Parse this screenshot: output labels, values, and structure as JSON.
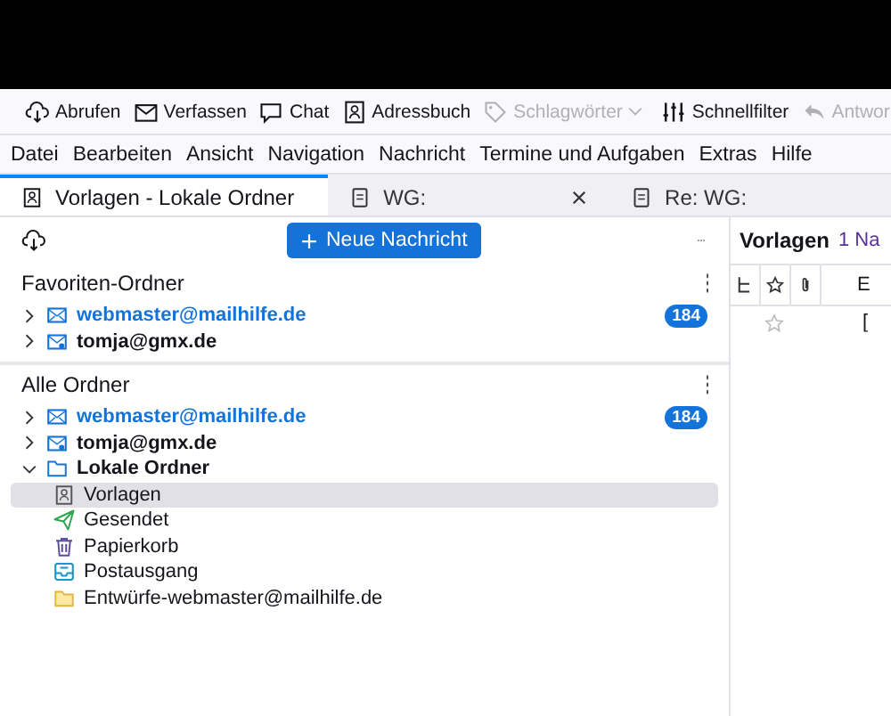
{
  "toolbar": {
    "buttons": [
      {
        "label": "Abrufen",
        "kind": "fetch",
        "disabled": false,
        "dropdown": false
      },
      {
        "label": "Verfassen",
        "kind": "compose",
        "disabled": false,
        "dropdown": false
      },
      {
        "label": "Chat",
        "kind": "chat",
        "disabled": false,
        "dropdown": false
      },
      {
        "label": "Adressbuch",
        "kind": "addressbook",
        "disabled": false,
        "dropdown": false
      },
      {
        "label": "Schlagwörter",
        "kind": "tag",
        "disabled": true,
        "dropdown": true
      },
      {
        "label": "Schnellfilter",
        "kind": "filter",
        "disabled": false,
        "dropdown": false
      },
      {
        "label": "Antwor",
        "kind": "reply",
        "disabled": true,
        "dropdown": false
      }
    ]
  },
  "menubar": {
    "items": [
      "Datei",
      "Bearbeiten",
      "Ansicht",
      "Navigation",
      "Nachricht",
      "Termine und Aufgaben",
      "Extras",
      "Hilfe"
    ]
  },
  "tabs": [
    {
      "label": "Vorlagen - Lokale Ordner",
      "kind": "folder",
      "selected": true,
      "closable": false
    },
    {
      "label": "WG:",
      "kind": "message",
      "selected": false,
      "closable": true
    },
    {
      "label": "Re: WG:",
      "kind": "message",
      "selected": false,
      "closable": false
    }
  ],
  "folder_pane": {
    "new_message_button": "Neue Nachricht",
    "sections": [
      {
        "title": "Favoriten-Ordner",
        "folders": [
          {
            "name": "webmaster@mailhilfe.de",
            "kind": "mail",
            "expanded": false,
            "unread": true,
            "selected": false,
            "count": "184"
          },
          {
            "name": "tomja@gmx.de",
            "kind": "mail-user",
            "expanded": false,
            "unread": false,
            "selected": false
          }
        ]
      },
      {
        "title": "Alle Ordner",
        "folders": [
          {
            "name": "webmaster@mailhilfe.de",
            "kind": "mail",
            "expanded": false,
            "unread": true,
            "selected": false,
            "count": "184"
          },
          {
            "name": "tomja@gmx.de",
            "kind": "mail-user",
            "expanded": false,
            "unread": false,
            "selected": false
          },
          {
            "name": "Lokale Ordner",
            "kind": "local",
            "expanded": true,
            "unread": false,
            "selected": false,
            "children": [
              {
                "name": "Vorlagen",
                "kind": "templates",
                "unread": false,
                "selected": true
              },
              {
                "name": "Gesendet",
                "kind": "sent",
                "unread": false,
                "selected": false
              },
              {
                "name": "Papierkorb",
                "kind": "trash",
                "unread": false,
                "selected": false
              },
              {
                "name": "Postausgang",
                "kind": "outbox",
                "unread": false,
                "selected": false
              },
              {
                "name": "Entwürfe-webmaster@mailhilfe.de",
                "kind": "drafts",
                "unread": false,
                "selected": false
              }
            ]
          }
        ]
      }
    ]
  },
  "message_pane": {
    "folder_title": "Vorlagen",
    "message_count": "1 Na",
    "columns": [
      {
        "kind": "thread"
      },
      {
        "kind": "star"
      },
      {
        "kind": "attachment"
      },
      {
        "kind": "text",
        "label": "E"
      }
    ],
    "rows": [
      {
        "starred": false,
        "cell": "["
      }
    ]
  }
}
